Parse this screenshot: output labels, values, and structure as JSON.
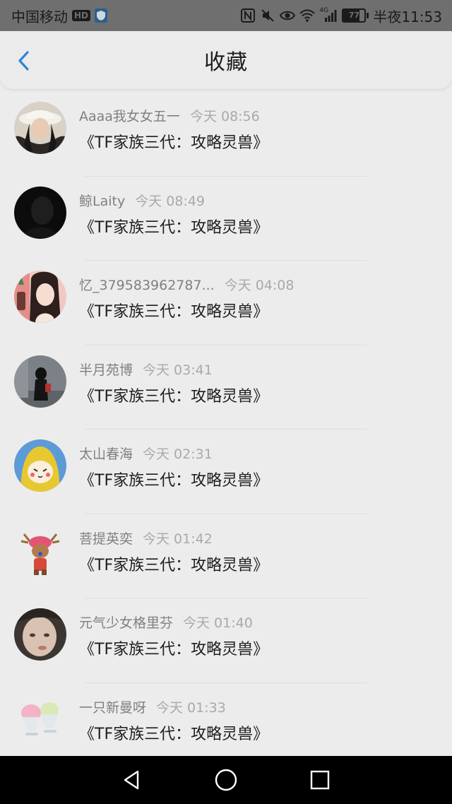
{
  "status_bar": {
    "carrier": "中国移动",
    "hd": "HD",
    "network": "4G",
    "battery": "77",
    "time": "半夜11:53"
  },
  "header": {
    "title": "收藏",
    "back_icon": "chevron-left-icon",
    "accent": "#2a86d9"
  },
  "items": [
    {
      "user": "Aaaa我女女五一",
      "time": "今天 08:56",
      "title": "《TF家族三代：攻略灵兽》",
      "avatar": "avatar-hat"
    },
    {
      "user": "鲸Laity",
      "time": "今天 08:49",
      "title": "《TF家族三代：攻略灵兽》",
      "avatar": "avatar-dark"
    },
    {
      "user": "忆_379583962787...",
      "time": "今天 04:08",
      "title": "《TF家族三代：攻略灵兽》",
      "avatar": "avatar-girl"
    },
    {
      "user": "半月苑博",
      "time": "今天 03:41",
      "title": "《TF家族三代：攻略灵兽》",
      "avatar": "avatar-street"
    },
    {
      "user": "太山春海",
      "time": "今天 02:31",
      "title": "《TF家族三代：攻略灵兽》",
      "avatar": "avatar-cartoon"
    },
    {
      "user": "菩提英奕",
      "time": "今天 01:42",
      "title": "《TF家族三代：攻略灵兽》",
      "avatar": "avatar-reindeer"
    },
    {
      "user": "元气少女格里芬",
      "time": "今天 01:40",
      "title": "《TF家族三代：攻略灵兽》",
      "avatar": "avatar-face"
    },
    {
      "user": "一只新曼呀",
      "time": "今天 01:33",
      "title": "《TF家族三代：攻略灵兽》",
      "avatar": "avatar-icecream"
    }
  ],
  "bottom_nav": {
    "back": "triangle-back-icon",
    "home": "circle-home-icon",
    "recents": "square-recents-icon"
  }
}
